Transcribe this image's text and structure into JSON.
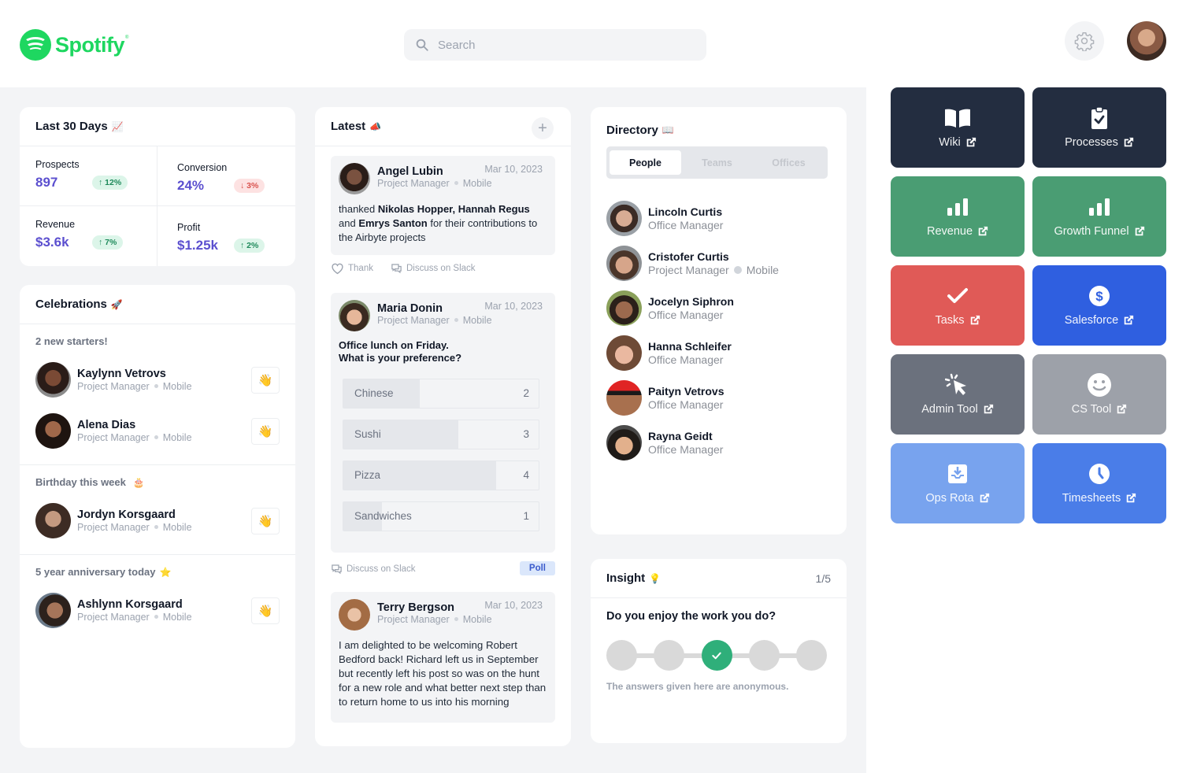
{
  "header": {
    "brand": "Spotify",
    "trademark": "®",
    "search_placeholder": "Search"
  },
  "stats": {
    "title": "Last 30 Days",
    "title_emoji": "📈",
    "items": [
      {
        "label": "Prospects",
        "value": "897",
        "change": "12%",
        "direction": "up",
        "arrow": "↑"
      },
      {
        "label": "Conversion",
        "value": "24%",
        "change": "3%",
        "direction": "down",
        "arrow": "↓"
      },
      {
        "label": "Revenue",
        "value": "$3.6k",
        "change": "7%",
        "direction": "up",
        "arrow": "↑"
      },
      {
        "label": "Profit",
        "value": "$1.25k",
        "change": "2%",
        "direction": "up",
        "arrow": "↑"
      }
    ]
  },
  "celebrations": {
    "title": "Celebrations",
    "title_emoji": "🚀",
    "sections": [
      {
        "title": "2 new starters!",
        "emoji": "",
        "people": [
          {
            "name": "Kaylynn Vetrovs",
            "role": "Project Manager",
            "team": "Mobile"
          },
          {
            "name": "Alena Dias",
            "role": "Project Manager",
            "team": "Mobile"
          }
        ]
      },
      {
        "title": "Birthday this week",
        "emoji": "🎂",
        "people": [
          {
            "name": "Jordyn Korsgaard",
            "role": "Project Manager",
            "team": "Mobile"
          }
        ]
      },
      {
        "title": "5 year anniversary today",
        "emoji": "⭐",
        "people": [
          {
            "name": "Ashlynn Korsgaard",
            "role": "Project Manager",
            "team": "Mobile"
          }
        ]
      }
    ],
    "wave_emoji": "👋"
  },
  "latest": {
    "title": "Latest",
    "title_emoji": "📣",
    "add_label": "+",
    "posts": [
      {
        "name": "Angel Lubin",
        "role": "Project Manager",
        "team": "Mobile",
        "date": "Mar 10, 2023",
        "body_1": "thanked ",
        "bold_1": "Nikolas Hopper, Hannah Regus",
        "body_2": " and ",
        "bold_2": "Emrys Santon",
        "body_3": " for their contributions to the Airbyte projects",
        "thank_label": "Thank",
        "slack_label": "Discuss on Slack"
      },
      {
        "name": "Maria Donin",
        "role": "Project Manager",
        "team": "Mobile",
        "date": "Mar 10, 2023",
        "question_line1": "Office lunch on Friday.",
        "question_line2": "What is your preference?",
        "poll": [
          {
            "label": "Chinese",
            "votes": 2
          },
          {
            "label": "Sushi",
            "votes": 3
          },
          {
            "label": "Pizza",
            "votes": 4
          },
          {
            "label": "Sandwiches",
            "votes": 1
          }
        ],
        "slack_label": "Discuss on Slack",
        "tag": "Poll"
      },
      {
        "name": "Terry Bergson",
        "role": "Project Manager",
        "team": "Mobile",
        "date": "Mar 10, 2023",
        "body": "I am delighted to be welcoming Robert Bedford back! Richard left us in September but recently left his post so was on the hunt for a new role and what better next step than to return home to us into his morning"
      }
    ]
  },
  "directory": {
    "title": "Directory",
    "title_emoji": "📖",
    "tabs": [
      "People",
      "Teams",
      "Offices"
    ],
    "active_tab": 0,
    "people": [
      {
        "name": "Lincoln Curtis",
        "role": "Office Manager",
        "team": ""
      },
      {
        "name": "Cristofer Curtis",
        "role": "Project Manager",
        "team": "Mobile"
      },
      {
        "name": "Jocelyn Siphron",
        "role": "Office Manager",
        "team": ""
      },
      {
        "name": "Hanna Schleifer",
        "role": "Office Manager",
        "team": ""
      },
      {
        "name": "Paityn Vetrovs",
        "role": "Office Manager",
        "team": ""
      },
      {
        "name": "Rayna Geidt",
        "role": "Office Manager",
        "team": ""
      }
    ]
  },
  "insight": {
    "title": "Insight",
    "title_emoji": "💡",
    "counter": "1/5",
    "question": "Do you enjoy the work you do?",
    "scale_points": 5,
    "selected_point": 3,
    "note": "The answers given here are anonymous."
  },
  "quick_links": [
    {
      "label": "Wiki",
      "icon": "book-icon",
      "color": "#232d40"
    },
    {
      "label": "Processes",
      "icon": "clipboard-check-icon",
      "color": "#232d40"
    },
    {
      "label": "Revenue",
      "icon": "bar-chart-icon",
      "color": "#4a9d73"
    },
    {
      "label": "Growth Funnel",
      "icon": "bar-chart-icon",
      "color": "#4a9d73"
    },
    {
      "label": "Tasks",
      "icon": "check-icon",
      "color": "#e05a57"
    },
    {
      "label": "Salesforce",
      "icon": "dollar-circle-icon",
      "color": "#2f5fe0"
    },
    {
      "label": "Admin Tool",
      "icon": "cursor-click-icon",
      "color": "#6b717d"
    },
    {
      "label": "CS Tool",
      "icon": "smiley-icon",
      "color": "#9da1a9"
    },
    {
      "label": "Ops Rota",
      "icon": "inbox-download-icon",
      "color": "#78a3ee"
    },
    {
      "label": "Timesheets",
      "icon": "clock-icon",
      "color": "#4a7de8"
    }
  ]
}
